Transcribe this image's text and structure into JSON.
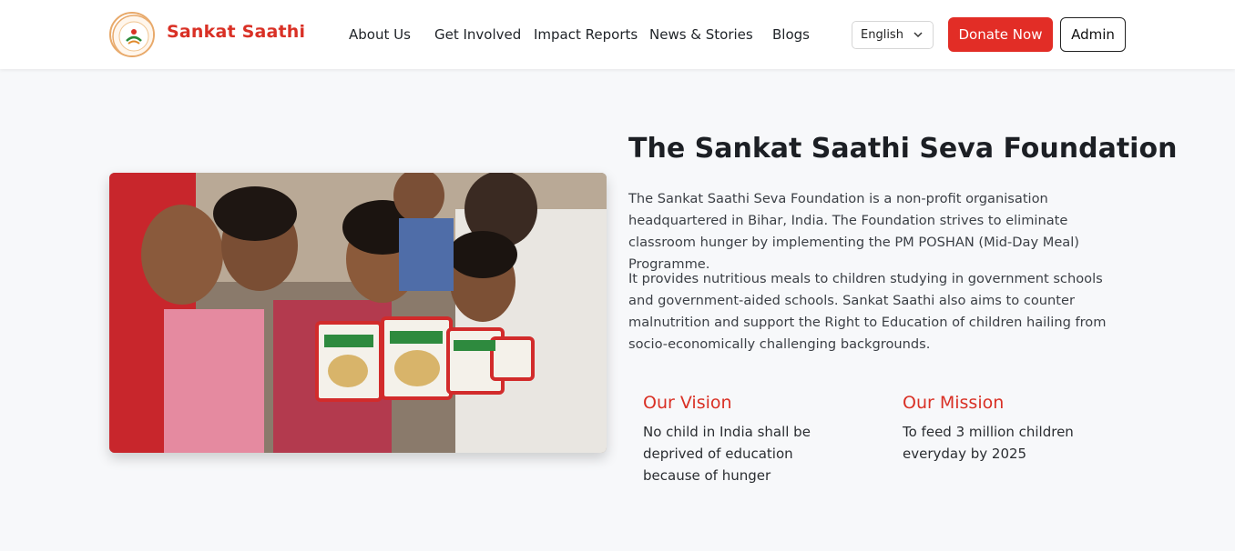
{
  "header": {
    "brand": "Sankat Saathi",
    "nav": [
      "About Us",
      "Get Involved",
      "Impact Reports",
      "News & Stories",
      "Blogs"
    ],
    "language": "English",
    "donate_label": "Donate Now",
    "admin_label": "Admin"
  },
  "hero": {
    "title": "The Sankat Saathi Seva Foundation",
    "paragraph1": "The Sankat Saathi Seva Foundation is a non-profit organisation headquartered in Bihar, India. The Foundation strives to eliminate classroom hunger by implementing the PM POSHAN (Mid-Day Meal) Programme.",
    "paragraph2": "It provides nutritious meals to children studying in government schools and government-aided schools. Sankat Saathi also aims to counter malnutrition and support the Right to Education of children hailing from socio-economically challenging backgrounds.",
    "vision_title": "Our Vision",
    "vision_text": "No child in India shall be deprived of education because of hunger",
    "mission_title": "Our Mission",
    "mission_text": "To feed 3 million children everyday by 2025"
  },
  "colors": {
    "accent": "#e22d26",
    "heading_red": "#d93025",
    "page_bg": "#f7f8fa"
  },
  "icons": {
    "logo": "foundation-logo",
    "language_chevron": "chevron-down-icon"
  }
}
